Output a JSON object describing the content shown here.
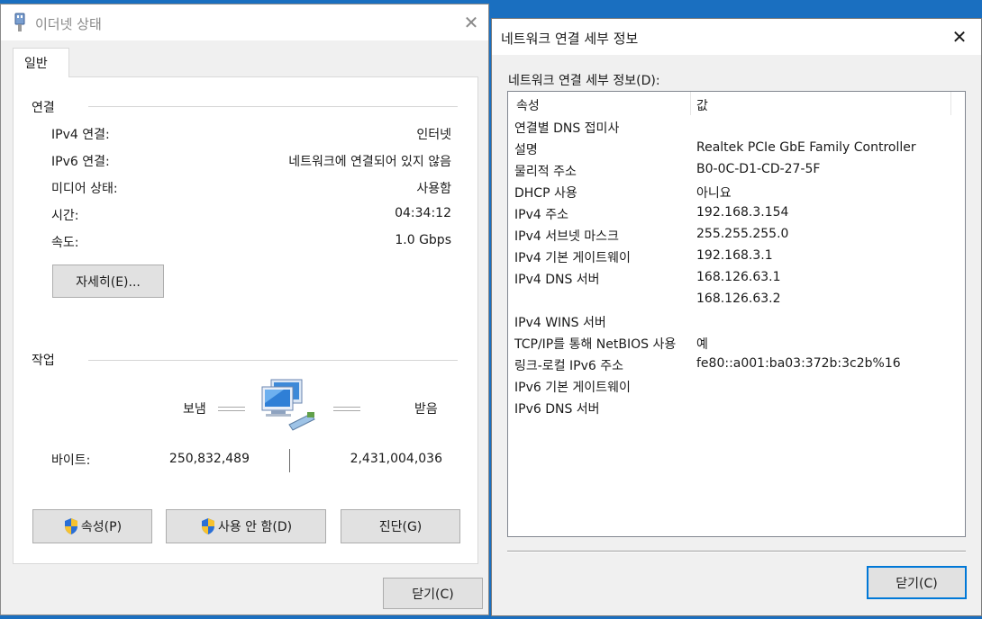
{
  "left_window": {
    "title": "이더넷 상태",
    "tab": "일반",
    "connection_group": "연결",
    "rows": [
      {
        "label": "IPv4 연결:",
        "value": "인터넷"
      },
      {
        "label": "IPv6 연결:",
        "value": "네트워크에 연결되어 있지 않음"
      },
      {
        "label": "미디어 상태:",
        "value": "사용함"
      },
      {
        "label": "시간:",
        "value": "04:34:12"
      },
      {
        "label": "속도:",
        "value": "1.0 Gbps"
      }
    ],
    "details_button": "자세히(E)...",
    "activity_group": "작업",
    "sent_label": "보냄",
    "received_label": "받음",
    "bytes_label": "바이트:",
    "bytes_sent": "250,832,489",
    "bytes_received": "2,431,004,036",
    "properties_button": "속성(P)",
    "disable_button": "사용 안 함(D)",
    "diagnose_button": "진단(G)",
    "close_button": "닫기(C)"
  },
  "right_window": {
    "title": "네트워크 연결 세부 정보",
    "list_label": "네트워크 연결 세부 정보(D):",
    "col_property": "속성",
    "col_value": "값",
    "rows": [
      {
        "name": "연결별 DNS 접미사",
        "value": ""
      },
      {
        "name": "설명",
        "value": "Realtek PCIe GbE Family Controller"
      },
      {
        "name": "물리적 주소",
        "value": "B0-0C-D1-CD-27-5F"
      },
      {
        "name": "DHCP 사용",
        "value": "아니요"
      },
      {
        "name": "IPv4 주소",
        "value": "192.168.3.154"
      },
      {
        "name": "IPv4 서브넷 마스크",
        "value": "255.255.255.0"
      },
      {
        "name": "IPv4 기본 게이트웨이",
        "value": "192.168.3.1"
      },
      {
        "name": "IPv4 DNS 서버",
        "value": "168.126.63.1"
      },
      {
        "name": "",
        "value": "168.126.63.2"
      },
      {
        "name": "IPv4 WINS 서버",
        "value": ""
      },
      {
        "name": "TCP/IP를 통해 NetBIOS 사용",
        "value": "예"
      },
      {
        "name": "링크-로컬 IPv6 주소",
        "value": "fe80::a001:ba03:372b:3c2b%16"
      },
      {
        "name": "IPv6 기본 게이트웨이",
        "value": ""
      },
      {
        "name": "IPv6 DNS 서버",
        "value": ""
      }
    ],
    "close_button": "닫기(C)"
  },
  "icons": {
    "adapter": "network-adapter-icon",
    "activity": "network-activity-icon",
    "shield": "uac-shield-icon"
  },
  "colors": {
    "desktop": "#1a6fc0",
    "accent": "#0078d7"
  }
}
